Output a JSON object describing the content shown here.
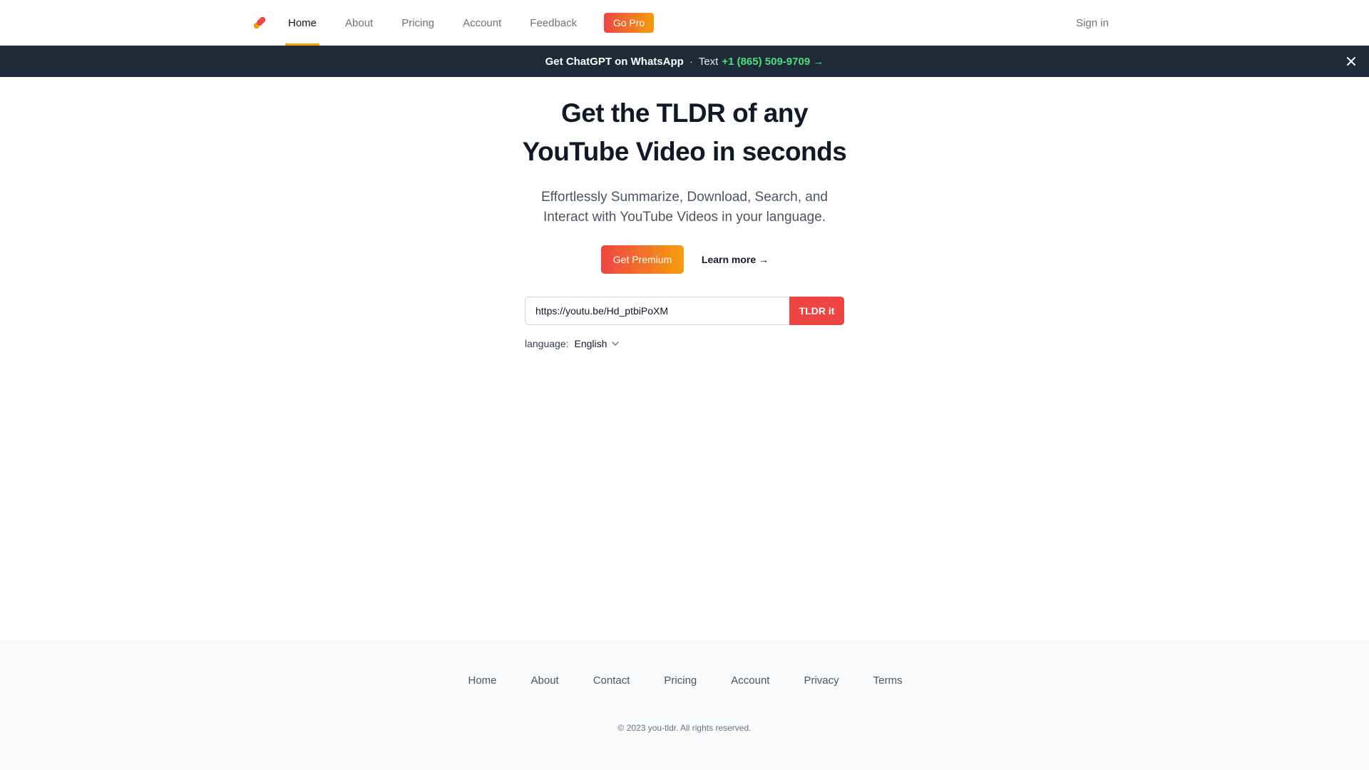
{
  "nav": {
    "logo_icon": "pencil-logo-icon",
    "items": [
      {
        "label": "Home",
        "active": true
      },
      {
        "label": "About",
        "active": false
      },
      {
        "label": "Pricing",
        "active": false
      },
      {
        "label": "Account",
        "active": false
      },
      {
        "label": "Feedback",
        "active": false
      }
    ],
    "go_pro_label": "Go Pro",
    "sign_in_label": "Sign in"
  },
  "banner": {
    "headline": "Get ChatGPT on WhatsApp",
    "separator": "·",
    "text_label": "Text",
    "phone_link": "+1 (865) 509-9709 →",
    "close_icon": "close-icon"
  },
  "hero": {
    "title_line1": "Get the TLDR of any",
    "title_line2": "YouTube Video in seconds",
    "subtitle_line1": "Effortlessly Summarize, Download, Search, and",
    "subtitle_line2": "Interact with YouTube Videos in your language.",
    "premium_button": "Get Premium",
    "learn_more": "Learn more →"
  },
  "form": {
    "url_value": "https://youtu.be/Hd_ptbiPoXM",
    "submit_label": "TLDR it",
    "language_label": "language:",
    "language_value": "English"
  },
  "footer": {
    "links": [
      "Home",
      "About",
      "Contact",
      "Pricing",
      "Account",
      "Privacy",
      "Terms"
    ],
    "copyright": "© 2023 you-tldr. All rights reserved."
  },
  "colors": {
    "accent_red": "#ef4444",
    "accent_orange": "#f59e0b",
    "banner_bg": "#1f2937",
    "phone_green": "#4ade80"
  }
}
